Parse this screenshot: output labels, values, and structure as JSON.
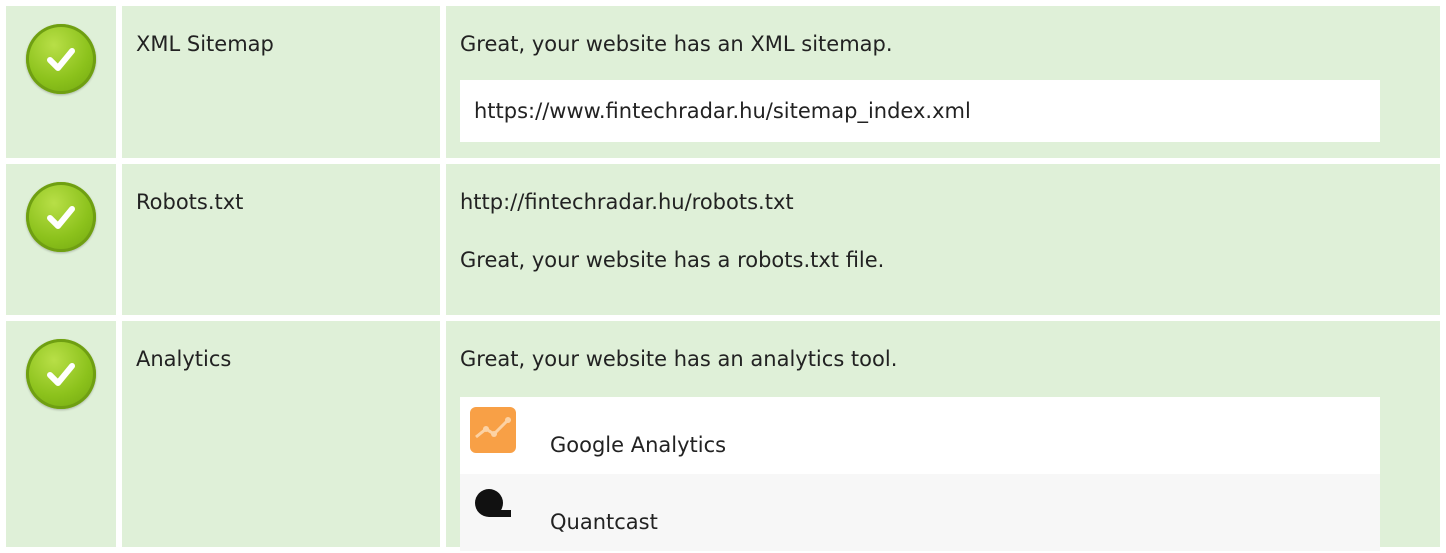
{
  "rows": [
    {
      "title": "XML Sitemap",
      "lines": [
        "Great, your website has an XML sitemap."
      ],
      "url": "https://www.fintechradar.hu/sitemap_index.xml"
    },
    {
      "title": "Robots.txt",
      "lines": [
        "http://fintechradar.hu/robots.txt",
        "Great, your website has a robots.txt file."
      ]
    },
    {
      "title": "Analytics",
      "lines": [
        "Great, your website has an analytics tool."
      ],
      "tools": [
        {
          "name": "Google Analytics",
          "icon": "google-analytics-icon"
        },
        {
          "name": "Quantcast",
          "icon": "quantcast-icon"
        }
      ]
    }
  ],
  "status_icon": "check-circle-icon",
  "colors": {
    "row_background": "#dff0d8",
    "check_green": "#8cc21c",
    "ga_orange": "#f8a046"
  }
}
